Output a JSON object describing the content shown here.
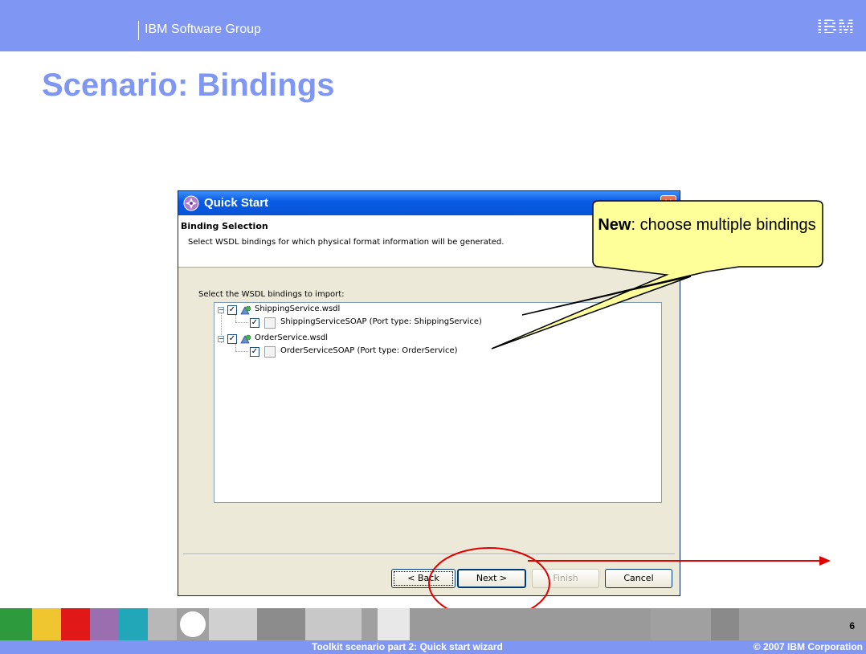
{
  "header": {
    "group": "IBM Software Group",
    "logo": "IBM"
  },
  "slide": {
    "title": "Scenario: Bindings",
    "page_number": "6"
  },
  "dialog": {
    "title": "Quick Start",
    "heading": "Binding Selection",
    "description": "Select WSDL bindings for which physical format information will be generated.",
    "select_label": "Select the WSDL bindings to import:",
    "tree": [
      {
        "label": "ShippingService.wsdl",
        "checked": true,
        "expanded": true,
        "children": [
          {
            "label": "ShippingServiceSOAP (Port type: ShippingService)",
            "checked": true
          }
        ]
      },
      {
        "label": "OrderService.wsdl",
        "checked": true,
        "expanded": true,
        "children": [
          {
            "label": "OrderServiceSOAP (Port type: OrderService)",
            "checked": true
          }
        ]
      }
    ],
    "buttons": {
      "back": "< Back",
      "next": "Next >",
      "finish": "Finish",
      "cancel": "Cancel"
    }
  },
  "callout": {
    "bold": "New",
    "text": ": choose multiple bindings"
  },
  "footer": {
    "center": "Toolkit scenario part 2:  Quick start wizard",
    "right": "© 2007 IBM Corporation"
  },
  "colors": {
    "brand": "#7f97f3",
    "callout_fill": "#ffff99",
    "annotation": "#e00000"
  }
}
